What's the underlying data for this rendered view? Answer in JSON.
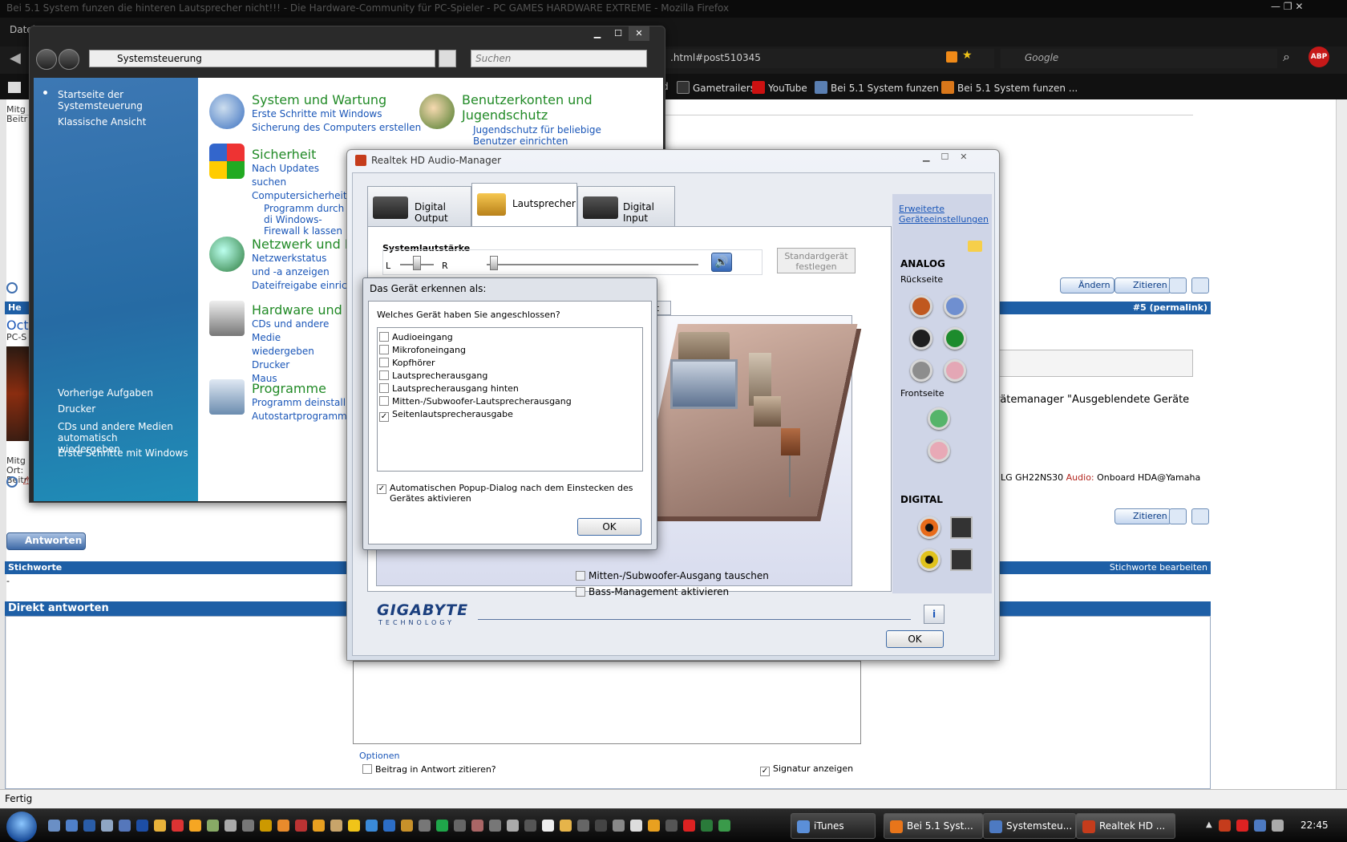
{
  "firefox": {
    "title": "Bei 5.1 System funzen die hinteren Lautsprecher nicht!!! - Die Hardware-Community für PC-Spieler - PC GAMES HARDWARE EXTREME - Mozilla Firefox",
    "menu_file": "Datei",
    "url_tail": ".html#post510345",
    "search_placeholder": "Google",
    "bookmarks": [
      "d",
      "Gametrailers",
      "YouTube",
      "Bei 5.1 System funzen ...",
      "Bei 5.1 System funzen ..."
    ],
    "status": "Fertig"
  },
  "forum": {
    "post_prefix_1": "Mitg",
    "post_prefix_2": "Beitr",
    "header_prefix": "He",
    "user_prefix": "Oct",
    "user_sub": "PC-S",
    "permalink": "#5 (permalink)",
    "edit_label": "Ändern",
    "quote_label": "Zitieren",
    "text_line": "rätemanager \"Ausgeblendete Geräte",
    "specs_prefix": "LG GH22NS30",
    "specs_audio_label": "Audio:",
    "specs_audio_value": "Onboard HDA@Yamaha",
    "meta_1": "Mitg",
    "meta_2": "Ort:",
    "meta_3": "Beitr",
    "reply_button": "Antworten",
    "keywords_label": "Stichworte",
    "keywords_value": "-",
    "keywords_edit": "Stichworte bearbeiten",
    "direct_reply": "Direkt antworten",
    "options": "Optionen",
    "quote_checkbox": "Beitrag in Antwort zitieren?",
    "signature_checkbox": "Signatur anzeigen"
  },
  "control_panel": {
    "address": "Systemsteuerung",
    "search_placeholder": "Suchen",
    "sidebar_top": [
      "Startseite der Systemsteuerung",
      "Klassische Ansicht"
    ],
    "sidebar_bottom_title": "Vorherige Aufgaben",
    "sidebar_bottom": [
      "Drucker",
      "CDs und andere Medien automatisch wiedergeben",
      "Erste Schritte mit Windows"
    ],
    "categories": [
      {
        "title": "System und Wartung",
        "links": [
          "Erste Schritte mit Windows",
          "Sicherung des Computers erstellen"
        ]
      },
      {
        "title": "Benutzerkonten und Jugendschutz",
        "links": [
          "Jugendschutz für beliebige Benutzer einrichten"
        ]
      },
      {
        "title": "Sicherheit",
        "links": [
          "Nach Updates suchen",
          "Computersicherheitsst",
          "Programm durch di Windows-Firewall k lassen"
        ]
      },
      {
        "title": "Netzwerk und Int",
        "links": [
          "Netzwerkstatus und -a anzeigen",
          "Dateifreigabe einricht"
        ]
      },
      {
        "title": "Hardware und So",
        "links": [
          "CDs und andere Medie wiedergeben",
          "Drucker",
          "Maus"
        ]
      },
      {
        "title": "Programme",
        "links": [
          "Programm deinstallier",
          "Autostartprogramme ä"
        ]
      }
    ]
  },
  "realtek": {
    "title": "Realtek HD Audio-Manager",
    "tabs": [
      "Digital Output",
      "Lautsprecher",
      "Digital Input"
    ],
    "volume_label": "Systemlautstärke",
    "left": "L",
    "right": "R",
    "default_button": "Standardgerät festlegen",
    "subtab_partial": "rmat",
    "swap_checkbox": "Mitten-/Subwoofer-Ausgang tauschen",
    "bass_checkbox": "Bass-Management aktivieren",
    "advanced_link": "Erweiterte Geräteeinstellungen",
    "analog": "ANALOG",
    "rear": "Rückseite",
    "front": "Frontseite",
    "digital": "DIGITAL",
    "brand": "GIGABYTE",
    "brand_sub": "TECHNOLOGY",
    "ok": "OK",
    "colors": {
      "rear_jacks": [
        "#c0581f",
        "#6f8fd0",
        "#1e1e1e",
        "#1d8b2c",
        "#8d8d8d",
        "#e4a7b5"
      ],
      "front_jacks": [
        "#56b46a",
        "#e8a9b6"
      ]
    }
  },
  "dialog": {
    "title": "Das Gerät erkennen als:",
    "question": "Welches Gerät haben Sie angeschlossen?",
    "options": [
      {
        "label": "Audioeingang",
        "checked": false
      },
      {
        "label": "Mikrofoneingang",
        "checked": false
      },
      {
        "label": "Kopfhörer",
        "checked": false
      },
      {
        "label": "Lautsprecherausgang",
        "checked": false
      },
      {
        "label": "Lautsprecherausgang hinten",
        "checked": false
      },
      {
        "label": "Mitten-/Subwoofer-Lautsprecherausgang",
        "checked": false
      },
      {
        "label": "Seitenlautsprecherausgabe",
        "checked": true
      }
    ],
    "auto_popup": "Automatischen Popup-Dialog nach dem Einstecken des Gerätes aktivieren",
    "auto_popup_checked": true,
    "ok": "OK"
  },
  "taskbar": {
    "tasks": [
      "iTunes",
      "Bei 5.1 Syst...",
      "Systemsteu...",
      "Realtek HD ..."
    ],
    "clock": "22:45"
  }
}
